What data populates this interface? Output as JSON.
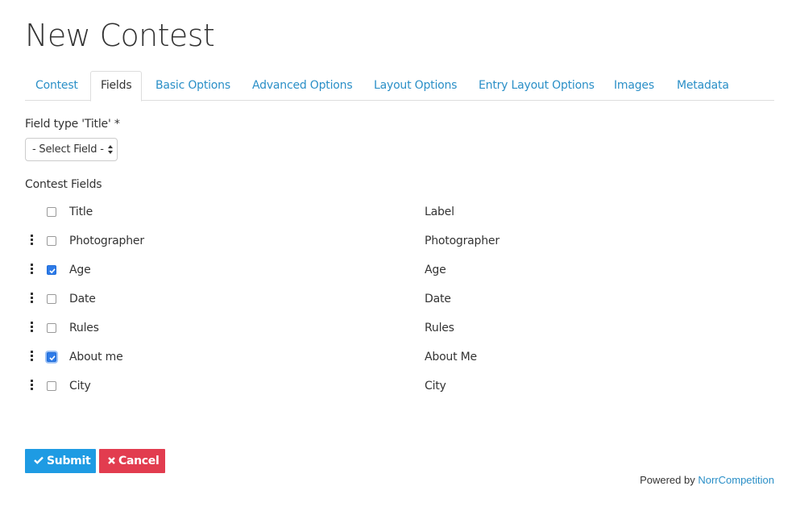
{
  "page": {
    "title": "New Contest"
  },
  "tabs": [
    {
      "label": "Contest"
    },
    {
      "label": "Fields"
    },
    {
      "label": "Basic Options"
    },
    {
      "label": "Advanced Options"
    },
    {
      "label": "Layout Options"
    },
    {
      "label": "Entry Layout Options"
    },
    {
      "label": "Images"
    },
    {
      "label": "Metadata"
    }
  ],
  "active_tab": "Fields",
  "field_type": {
    "label": "Field type 'Title' *",
    "selected": "- Select Field -"
  },
  "contest_fields": {
    "label": "Contest Fields",
    "header": {
      "title": "Title",
      "label": "Label"
    },
    "rows": [
      {
        "title": "Photographer",
        "label": "Photographer",
        "checked": false
      },
      {
        "title": "Age",
        "label": "Age",
        "checked": true
      },
      {
        "title": "Date",
        "label": "Date",
        "checked": false
      },
      {
        "title": "Rules",
        "label": "Rules",
        "checked": false
      },
      {
        "title": "About me",
        "label": "About Me",
        "checked": true,
        "focused": true
      },
      {
        "title": "City",
        "label": "City",
        "checked": false
      }
    ]
  },
  "buttons": {
    "submit": "Submit",
    "cancel": "Cancel"
  },
  "footer": {
    "prefix": "Powered by",
    "link": "NorrCompetition"
  },
  "colors": {
    "link": "#2a8fc7",
    "submit": "#1e9be3",
    "cancel": "#e23c4f",
    "checkbox_checked": "#2e7be8"
  }
}
